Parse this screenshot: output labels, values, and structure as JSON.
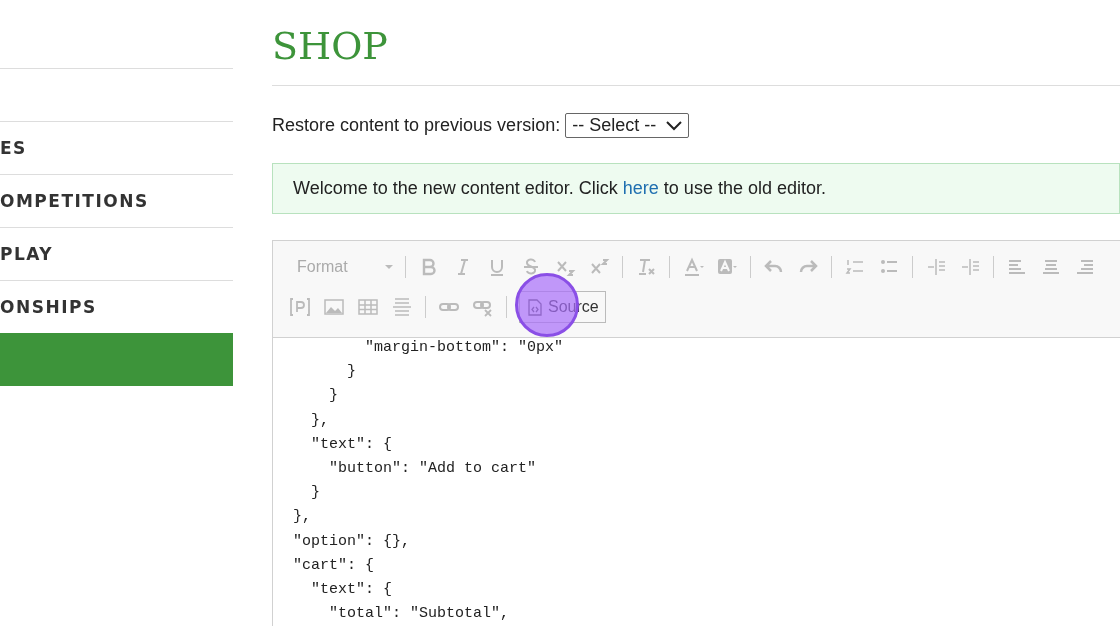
{
  "sidebar": {
    "items": [
      {
        "selected": false
      },
      {
        "label": "ES",
        "selected": false
      },
      {
        "label": "OMPETITIONS",
        "selected": false
      },
      {
        "label": "PLAY",
        "selected": false
      },
      {
        "label": "ONSHIPS",
        "selected": false
      },
      {
        "selected": true
      }
    ]
  },
  "page_title": "SHOP",
  "restore": {
    "label": "Restore content to previous version:",
    "select": "-- Select --"
  },
  "notice": {
    "before": "Welcome to the new content editor. Click ",
    "link": "here",
    "after": " to use the old editor."
  },
  "editor": {
    "format": {
      "label": "Format",
      "disabled": true
    },
    "source_button": {
      "label": "Source",
      "highlighted": true
    },
    "code_lines": [
      "        \"margin-bottom\": \"0px\"",
      "      }",
      "    }",
      "  },",
      "  \"text\": {",
      "    \"button\": \"Add to cart\"",
      "  }",
      "},",
      "\"option\": {},",
      "\"cart\": {",
      "  \"text\": {",
      "    \"total\": \"Subtotal\","
    ]
  }
}
